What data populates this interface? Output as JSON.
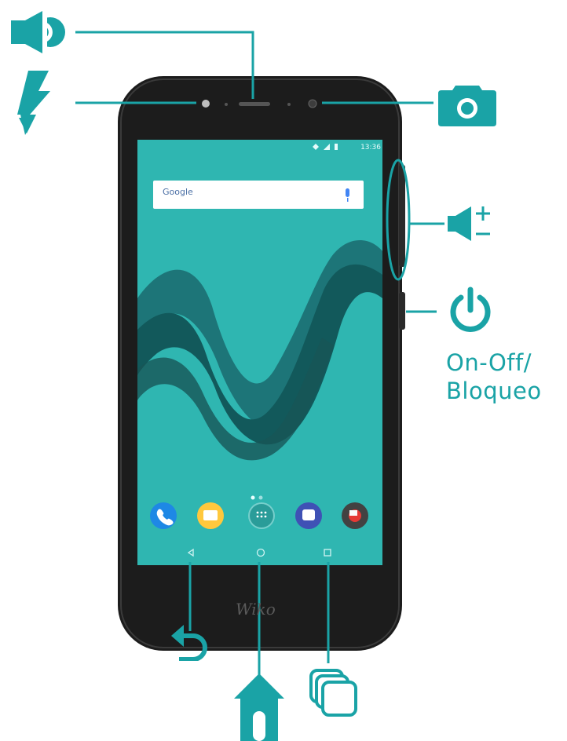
{
  "labels": {
    "onoff_line1": "On-Off/",
    "onoff_line2": "Bloqueo"
  },
  "screen": {
    "status_time": "13:36",
    "search_placeholder": "Google",
    "brand_logo": "Wiko"
  },
  "icons": [
    "speaker-icon",
    "flash-icon",
    "camera-icon",
    "volume-up-down-icon",
    "power-icon",
    "back-icon",
    "home-icon",
    "recent-apps-icon"
  ],
  "colors": {
    "accent": "#1aa3a6",
    "phone_body": "#1c1c1c",
    "screen_bg": "#2fb6b1"
  }
}
